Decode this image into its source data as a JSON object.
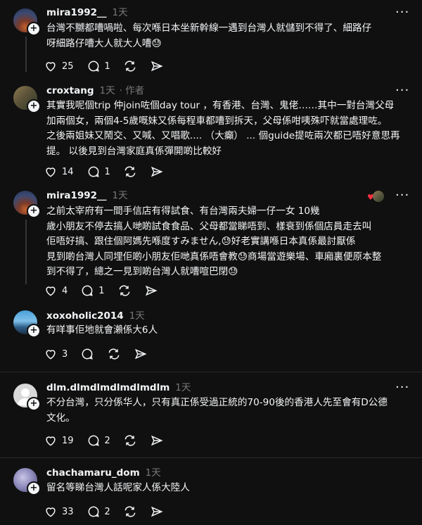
{
  "colors": {
    "background": "#101010",
    "text": "#f3f5f7",
    "muted": "#777777",
    "divider": "#2a2a2a"
  },
  "posts": [
    {
      "username": "mira1992__",
      "time": "1天",
      "author_tag": "",
      "text": "台灣不嬲都嘈喎啦、每次喺日本坐新幹線一遇到台灣人就儲到不得了、細路仔\n呀細路仔嘈大人就大人嘈😓",
      "likes": "25",
      "replies": "1",
      "reposts": "",
      "shares": ""
    },
    {
      "username": "croxtang",
      "time": "1天",
      "author_tag": "· 作者",
      "text": "其實我呢個trip 仲join咗個day tour ，有香港、台灣、鬼佬……其中一對台灣父母\n加兩個女，兩個4-5歲嘅妹又係每程車都嘈到拆天，父母係咁咦殊吓就當處理咗。\n之後兩姐妹又鬧交、又喊、又唱歌.... （大癲） ... 個guide提咗兩次都已唔好意思再\n提。 以後見到台灣家庭真係彈開啲比較好",
      "likes": "14",
      "replies": "1",
      "reposts": "",
      "shares": ""
    },
    {
      "username": "mira1992__",
      "time": "1天",
      "author_tag": "",
      "text": "之前太宰府有一間手信店有得試食、有台灣兩夫婦一仔一女 10幾\n歲小朋友不停去搞人哋啲試食食品、父母都當睇唔到、樣衰到係個店員走去叫\n佢唔好搞、跟住個阿媽先喺度すみません,😓好老實講喺日本真係最討厭係\n見到啲台灣人同埋佢啲小朋友佢哋真係唔會教😓商場當遊樂場、車廂裏便原本整\n到不得了，總之一見到啲台灣人就嘈喧巴閉😓",
      "likes": "4",
      "replies": "1",
      "reposts": "",
      "shares": ""
    },
    {
      "username": "xoxoholic2014",
      "time": "1天",
      "author_tag": "",
      "text": "有咩事佢地就會瀨係大6人",
      "likes": "3",
      "replies": "",
      "reposts": "",
      "shares": ""
    },
    {
      "username": "dlm.dlmdlmdlmdlmdlm",
      "time": "1天",
      "author_tag": "",
      "text": "不分台灣，只分係华人，只有真正係受過正統的70-90後的香港人先至會有D公德\n文化。",
      "likes": "19",
      "replies": "2",
      "reposts": "",
      "shares": ""
    },
    {
      "username": "chachamaru_dom",
      "time": "1天",
      "author_tag": "",
      "text": "留名等睇台灣人話呢家人係大陸人",
      "likes": "33",
      "replies": "2",
      "reposts": "",
      "shares": ""
    }
  ],
  "icons": {
    "like": "heart-icon",
    "reply": "comment-icon",
    "repost": "repost-icon",
    "share": "share-icon",
    "more": "more-icon",
    "follow": "plus-icon"
  }
}
